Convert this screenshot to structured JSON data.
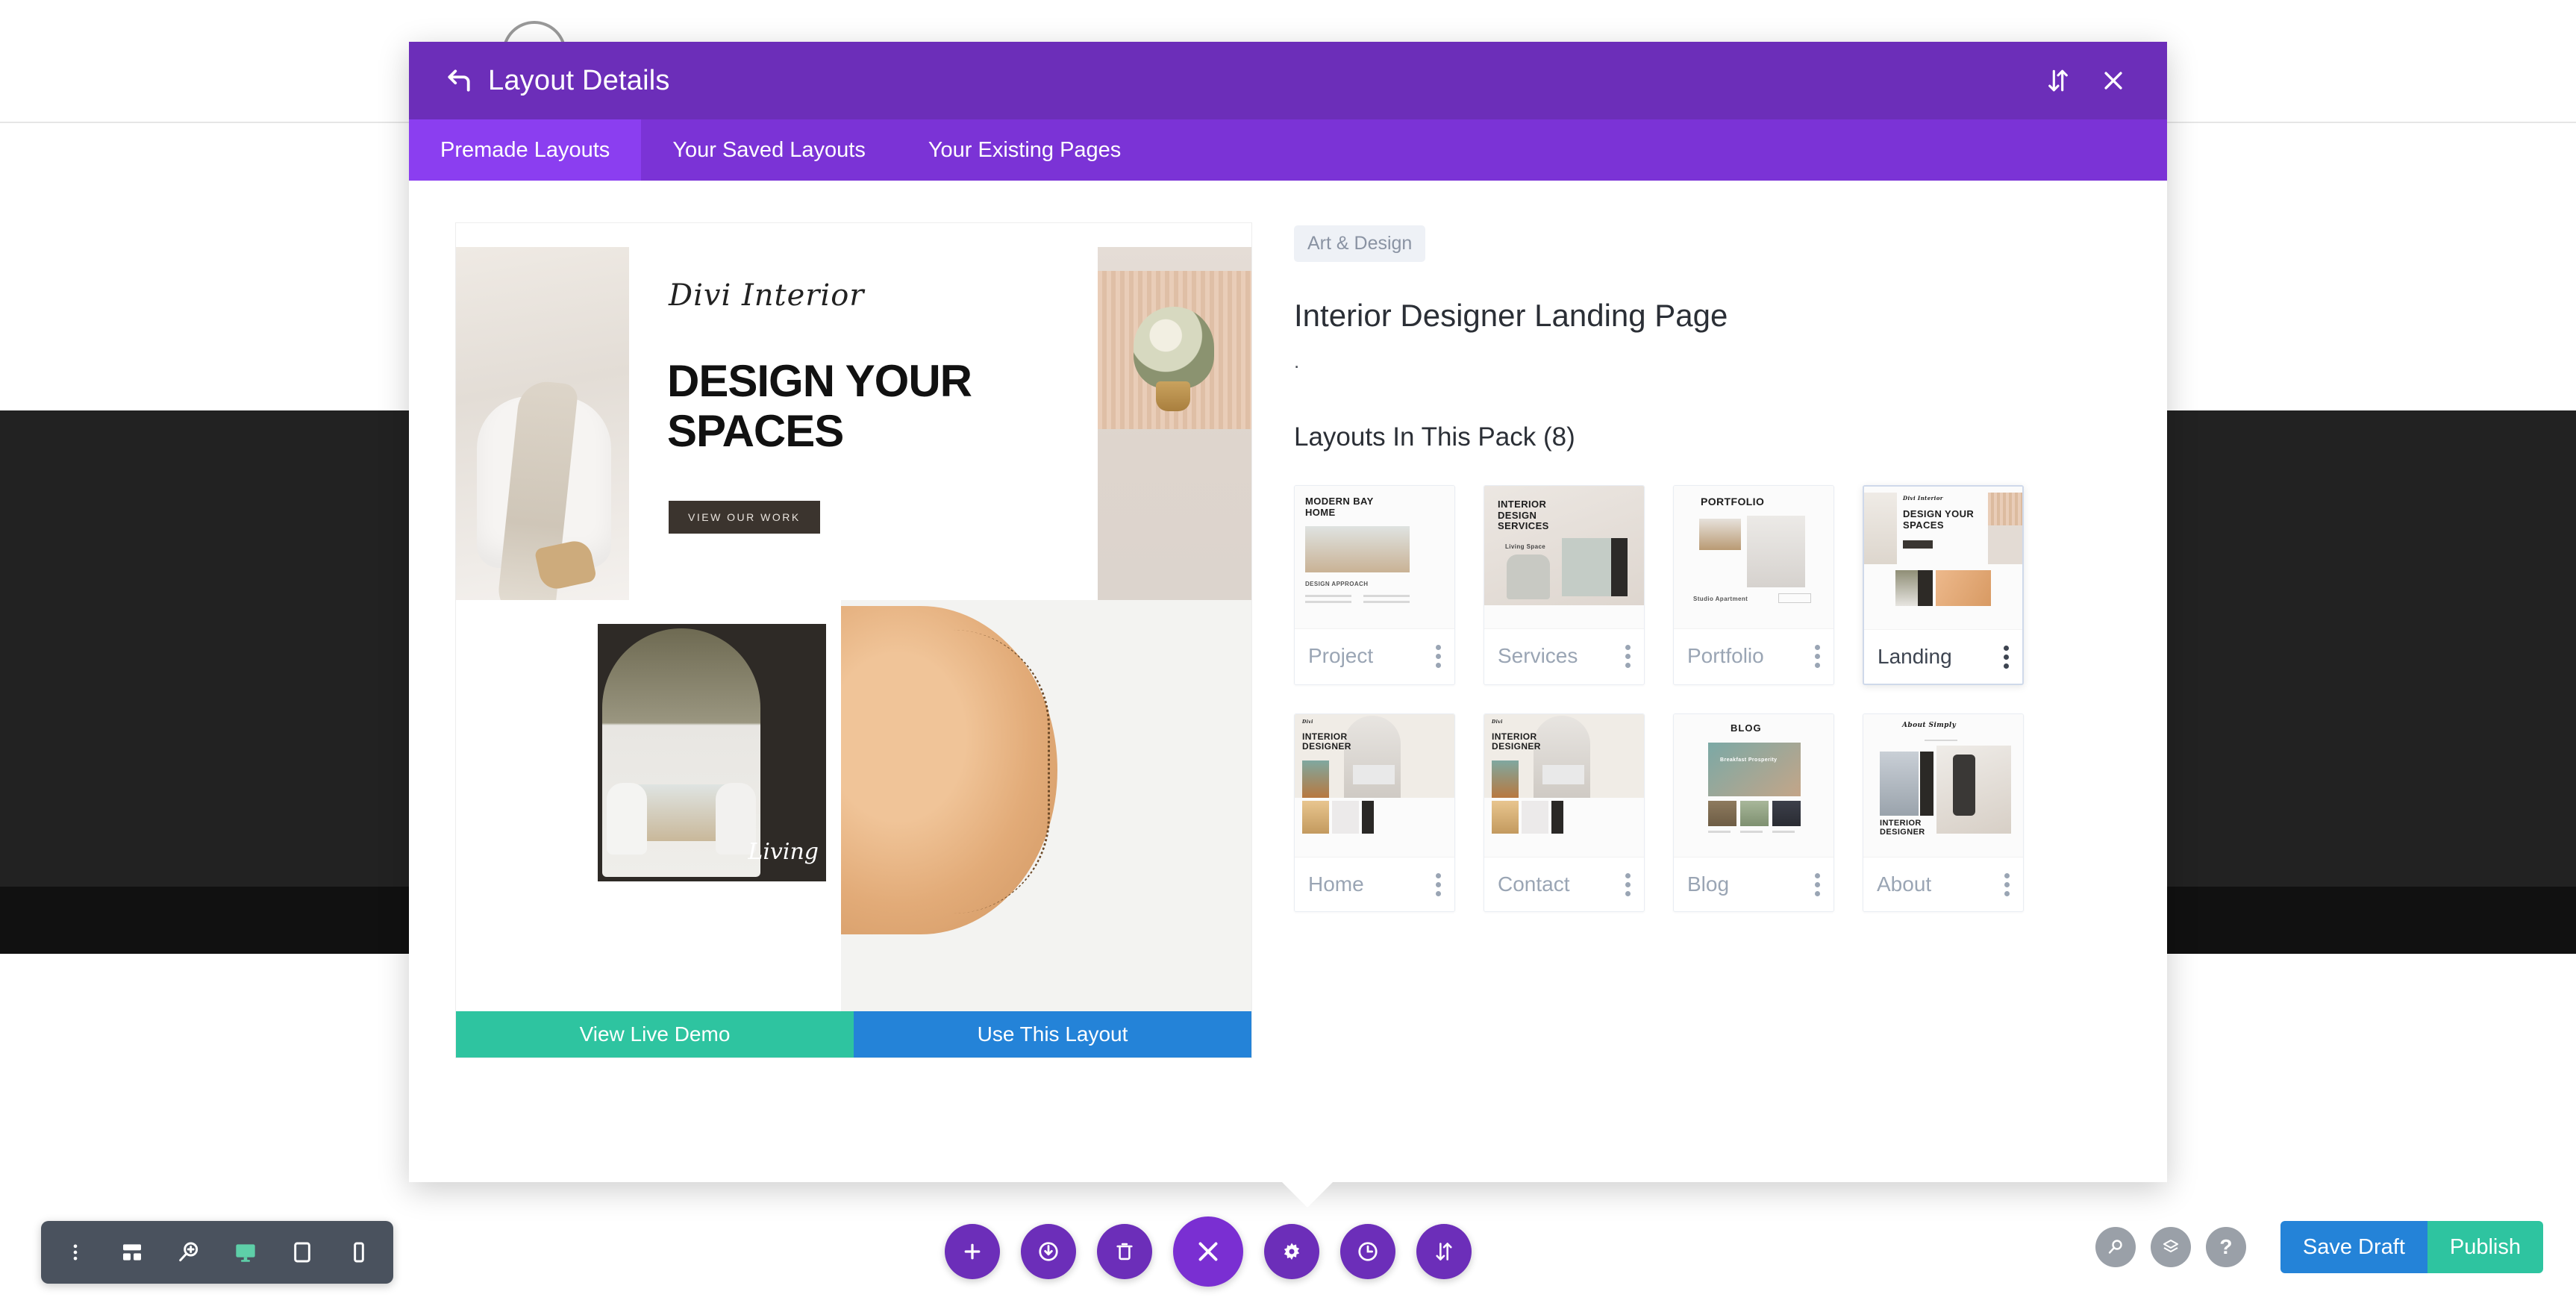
{
  "modal": {
    "title": "Layout Details",
    "back_icon": "back-arrow-icon",
    "sort_icon": "sort-arrows-icon",
    "close_icon": "close-icon",
    "tabs": [
      {
        "label": "Premade Layouts",
        "active": true
      },
      {
        "label": "Your Saved Layouts",
        "active": false
      },
      {
        "label": "Your Existing Pages",
        "active": false
      }
    ]
  },
  "preview": {
    "logo": "Divi Interior",
    "headline": "DESIGN YOUR SPACES",
    "cta": "VIEW OUR WORK",
    "living_label": "Living",
    "demo_button": "View Live Demo",
    "use_button": "Use This Layout"
  },
  "info": {
    "category_badge": "Art & Design",
    "pack_title": "Interior Designer Landing Page",
    "pack_description": ".",
    "layouts_heading": "Layouts In This Pack (8)"
  },
  "layout_cards": [
    {
      "name": "Project",
      "selected": false,
      "thumb_title": "MODERN BAY HOME",
      "thumb_sub": "DESIGN APPROACH"
    },
    {
      "name": "Services",
      "selected": false,
      "thumb_title": "INTERIOR DESIGN SERVICES",
      "thumb_sub": "Living Space"
    },
    {
      "name": "Portfolio",
      "selected": false,
      "thumb_title": "PORTFOLIO",
      "thumb_sub": "Studio Apartment"
    },
    {
      "name": "Landing",
      "selected": true,
      "thumb_title": "DESIGN YOUR SPACES",
      "thumb_sub": "Divi Interior"
    },
    {
      "name": "Home",
      "selected": false,
      "thumb_title": "INTERIOR DESIGNER",
      "thumb_sub": "Divi"
    },
    {
      "name": "Contact",
      "selected": false,
      "thumb_title": "INTERIOR DESIGNER",
      "thumb_sub": "Divi"
    },
    {
      "name": "Blog",
      "selected": false,
      "thumb_title": "BLOG",
      "thumb_sub": "Breakfast Prosperity"
    },
    {
      "name": "About",
      "selected": false,
      "thumb_title": "INTERIOR DESIGNER",
      "thumb_sub": "About Simply"
    }
  ],
  "toolbar_left": {
    "icons": [
      "more-options-icon",
      "wireframe-icon",
      "zoom-search-icon",
      "desktop-view-icon",
      "tablet-view-icon",
      "phone-view-icon"
    ],
    "active_icon": "desktop-view-icon"
  },
  "toolbar_center": {
    "icons": [
      "add-icon",
      "load-layout-icon",
      "trash-icon",
      "close-builder-icon",
      "settings-gear-icon",
      "history-clock-icon",
      "sort-arrows-icon"
    ]
  },
  "toolbar_right": {
    "icons": [
      "search-icon",
      "layers-icon",
      "help-icon"
    ],
    "save_draft_label": "Save Draft",
    "publish_label": "Publish"
  },
  "colors": {
    "header_purple": "#6C2EB9",
    "tabbar_purple": "#7B33D6",
    "tab_active_purple": "#8B3EF0",
    "teal": "#2EC4A0",
    "blue": "#2483D8",
    "toolbar_dark": "#4A525E"
  }
}
